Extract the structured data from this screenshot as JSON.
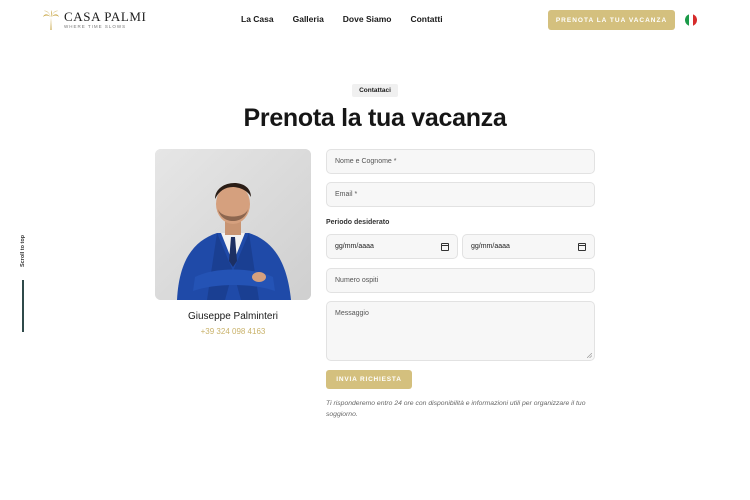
{
  "header": {
    "brand_name": "CASA PALMI",
    "brand_tagline": "WHERE TIME SLOWS",
    "nav": [
      "La Casa",
      "Galleria",
      "Dove Siamo",
      "Contatti"
    ],
    "cta_label": "PRENOTA LA TUA VACANZA",
    "language_flag": "italy-flag-icon"
  },
  "scroll_top": {
    "label": "Scroll to top"
  },
  "section": {
    "badge": "Contattaci",
    "title": "Prenota la tua vacanza"
  },
  "contact_person": {
    "name": "Giuseppe Palminteri",
    "phone": "+39 324 098 4163"
  },
  "form": {
    "name_placeholder": "Nome e Cognome *",
    "email_placeholder": "Email *",
    "period_label": "Periodo desiderato",
    "date_from": "gg/mm/aaaa",
    "date_to": "gg/mm/aaaa",
    "guests_placeholder": "Numero ospiti",
    "message_placeholder": "Messaggio",
    "submit_label": "INVIA RICHIESTA",
    "note": "Ti risponderemo entro 24 ore con disponibilità e informazioni utili per organizzare il tuo soggiorno."
  },
  "colors": {
    "accent": "#d4c07e",
    "phone": "#c9b26a",
    "field_bg": "#f7f7f7",
    "suit": "#1f4aa8"
  }
}
